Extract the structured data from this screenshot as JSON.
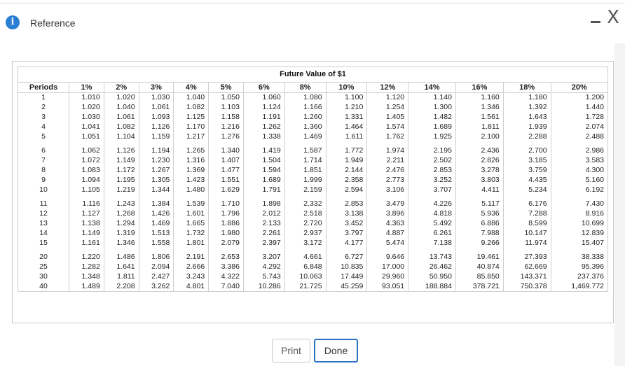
{
  "dialog": {
    "title": "Reference",
    "close_glyph": "X",
    "minimize_glyph": "—"
  },
  "table": {
    "caption": "Future Value of $1",
    "headers": [
      "Periods",
      "1%",
      "2%",
      "3%",
      "4%",
      "5%",
      "6%",
      "8%",
      "10%",
      "12%",
      "14%",
      "16%",
      "18%",
      "20%"
    ],
    "groups": [
      [
        [
          "1",
          "1.010",
          "1.020",
          "1.030",
          "1.040",
          "1.050",
          "1.060",
          "1.080",
          "1.100",
          "1.120",
          "1.140",
          "1.160",
          "1.180",
          "1.200"
        ],
        [
          "2",
          "1.020",
          "1.040",
          "1.061",
          "1.082",
          "1.103",
          "1.124",
          "1.166",
          "1.210",
          "1.254",
          "1.300",
          "1.346",
          "1.392",
          "1.440"
        ],
        [
          "3",
          "1.030",
          "1.061",
          "1.093",
          "1.125",
          "1.158",
          "1.191",
          "1.260",
          "1.331",
          "1.405",
          "1.482",
          "1.561",
          "1.643",
          "1.728"
        ],
        [
          "4",
          "1.041",
          "1.082",
          "1.126",
          "1.170",
          "1.216",
          "1.262",
          "1.360",
          "1.464",
          "1.574",
          "1.689",
          "1.811",
          "1.939",
          "2.074"
        ],
        [
          "5",
          "1.051",
          "1.104",
          "1.159",
          "1.217",
          "1.276",
          "1.338",
          "1.469",
          "1.611",
          "1.762",
          "1.925",
          "2.100",
          "2.288",
          "2.488"
        ]
      ],
      [
        [
          "6",
          "1.062",
          "1.126",
          "1.194",
          "1.265",
          "1.340",
          "1.419",
          "1.587",
          "1.772",
          "1.974",
          "2.195",
          "2.436",
          "2.700",
          "2.986"
        ],
        [
          "7",
          "1.072",
          "1.149",
          "1.230",
          "1.316",
          "1.407",
          "1.504",
          "1.714",
          "1.949",
          "2.211",
          "2.502",
          "2.826",
          "3.185",
          "3.583"
        ],
        [
          "8",
          "1.083",
          "1.172",
          "1.267",
          "1.369",
          "1.477",
          "1.594",
          "1.851",
          "2.144",
          "2.476",
          "2.853",
          "3.278",
          "3.759",
          "4.300"
        ],
        [
          "9",
          "1.094",
          "1.195",
          "1.305",
          "1.423",
          "1.551",
          "1.689",
          "1.999",
          "2.358",
          "2.773",
          "3.252",
          "3.803",
          "4.435",
          "5.160"
        ],
        [
          "10",
          "1.105",
          "1.219",
          "1.344",
          "1.480",
          "1.629",
          "1.791",
          "2.159",
          "2.594",
          "3.106",
          "3.707",
          "4.411",
          "5.234",
          "6.192"
        ]
      ],
      [
        [
          "11",
          "1.116",
          "1.243",
          "1.384",
          "1.539",
          "1.710",
          "1.898",
          "2.332",
          "2.853",
          "3.479",
          "4.226",
          "5.117",
          "6.176",
          "7.430"
        ],
        [
          "12",
          "1.127",
          "1.268",
          "1.426",
          "1.601",
          "1.796",
          "2.012",
          "2.518",
          "3.138",
          "3.896",
          "4.818",
          "5.936",
          "7.288",
          "8.916"
        ],
        [
          "13",
          "1.138",
          "1.294",
          "1.469",
          "1.665",
          "1.886",
          "2.133",
          "2.720",
          "3.452",
          "4.363",
          "5.492",
          "6.886",
          "8.599",
          "10.699"
        ],
        [
          "14",
          "1.149",
          "1.319",
          "1.513",
          "1.732",
          "1.980",
          "2.261",
          "2.937",
          "3.797",
          "4.887",
          "6.261",
          "7.988",
          "10.147",
          "12.839"
        ],
        [
          "15",
          "1.161",
          "1.346",
          "1.558",
          "1.801",
          "2.079",
          "2.397",
          "3.172",
          "4.177",
          "5.474",
          "7.138",
          "9.266",
          "11.974",
          "15.407"
        ]
      ],
      [
        [
          "20",
          "1.220",
          "1.486",
          "1.806",
          "2.191",
          "2.653",
          "3.207",
          "4.661",
          "6.727",
          "9.646",
          "13.743",
          "19.461",
          "27.393",
          "38.338"
        ],
        [
          "25",
          "1.282",
          "1.641",
          "2.094",
          "2.666",
          "3.386",
          "4.292",
          "6.848",
          "10.835",
          "17.000",
          "26.462",
          "40.874",
          "62.669",
          "95.396"
        ],
        [
          "30",
          "1.348",
          "1.811",
          "2.427",
          "3.243",
          "4.322",
          "5.743",
          "10.063",
          "17.449",
          "29.960",
          "50.950",
          "85.850",
          "143.371",
          "237.376"
        ],
        [
          "40",
          "1.489",
          "2.208",
          "3.262",
          "4.801",
          "7.040",
          "10.286",
          "21.725",
          "45.259",
          "93.051",
          "188.884",
          "378.721",
          "750.378",
          "1,469.772"
        ]
      ]
    ]
  },
  "buttons": {
    "print": "Print",
    "done": "Done"
  },
  "colors": {
    "info_icon": "#2a7fd3",
    "done_border": "#2b74c4",
    "grid": "#cfcfcf"
  },
  "icons": {
    "info": "info-icon",
    "minimize": "minimize-icon",
    "close": "close-icon"
  }
}
